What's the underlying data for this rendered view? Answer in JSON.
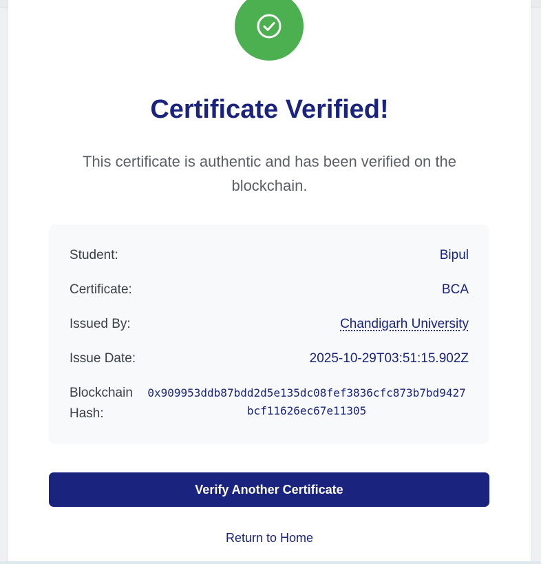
{
  "header": {
    "title": "Certificate Verified!",
    "subtitle": "This certificate is authentic and has been verified on the blockchain.",
    "status_icon": "check-circle-icon",
    "status_color": "#4caf50"
  },
  "details": {
    "student_label": "Student:",
    "student_value": "Bipul",
    "certificate_label": "Certificate:",
    "certificate_value": "BCA",
    "issued_by_label": "Issued By:",
    "issued_by_value": "Chandigarh University",
    "issue_date_label": "Issue Date:",
    "issue_date_value": "2025-10-29T03:51:15.902Z",
    "hash_label": "Blockchain Hash:",
    "hash_value": "0x909953ddb87bdd2d5e135dc08fef3836cfc873b7bd9427bcf11626ec67e11305"
  },
  "actions": {
    "verify_another_label": "Verify Another Certificate",
    "return_home_label": "Return to Home"
  },
  "colors": {
    "primary": "#1a237e",
    "success": "#4caf50",
    "panel_bg": "#f7f9fa"
  }
}
